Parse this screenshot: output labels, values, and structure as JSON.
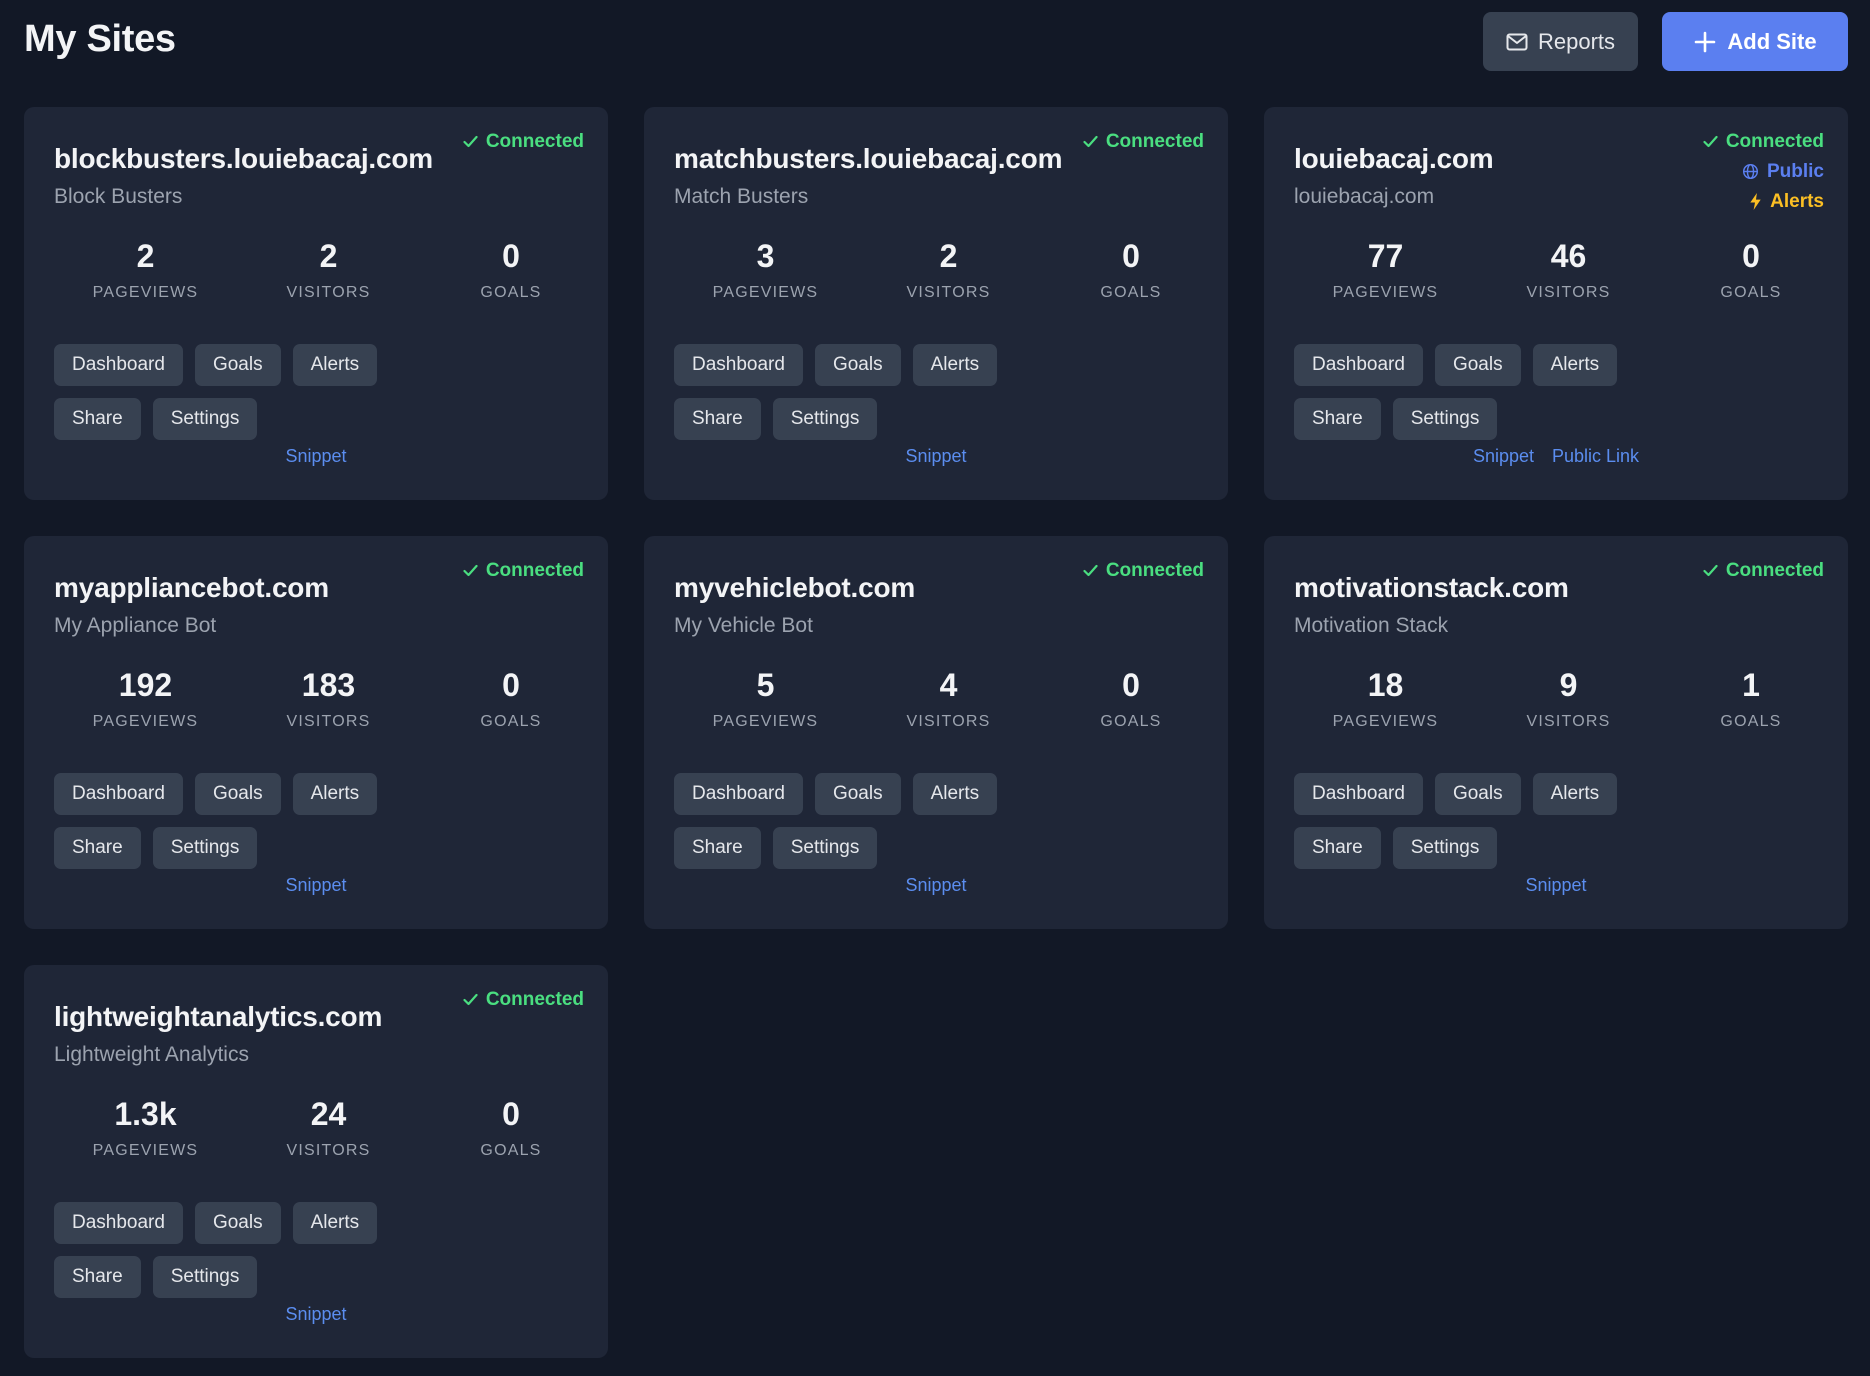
{
  "page": {
    "title": "My Sites",
    "reports_label": "Reports",
    "add_site_label": "Add Site"
  },
  "colors": {
    "background": "#121826",
    "card": "#1f2637",
    "button": "#374151",
    "accent": "#5b7ff0",
    "connected": "#4ade80",
    "alerts": "#fbbf24",
    "link": "#5b8def"
  },
  "icons": {
    "reports": "mail-icon",
    "add_site": "plus-icon",
    "connected": "check-icon",
    "public": "globe-icon",
    "alerts": "bolt-icon"
  },
  "labels": {
    "connected": "Connected",
    "public": "Public",
    "alerts": "Alerts",
    "pageviews": "PAGEVIEWS",
    "visitors": "VISITORS",
    "goals": "GOALS",
    "dashboard": "Dashboard",
    "goals_btn": "Goals",
    "alerts_btn": "Alerts",
    "share": "Share",
    "settings": "Settings",
    "snippet": "Snippet",
    "public_link": "Public Link"
  },
  "sites": [
    {
      "domain": "blockbusters.louiebacaj.com",
      "name": "Block Busters",
      "pageviews": "2",
      "visitors": "2",
      "goals": "0",
      "public": false,
      "alerts": false
    },
    {
      "domain": "matchbusters.louiebacaj.com",
      "name": "Match Busters",
      "pageviews": "3",
      "visitors": "2",
      "goals": "0",
      "public": false,
      "alerts": false
    },
    {
      "domain": "louiebacaj.com",
      "name": "louiebacaj.com",
      "pageviews": "77",
      "visitors": "46",
      "goals": "0",
      "public": true,
      "alerts": true
    },
    {
      "domain": "myappliancebot.com",
      "name": "My Appliance Bot",
      "pageviews": "192",
      "visitors": "183",
      "goals": "0",
      "public": false,
      "alerts": false
    },
    {
      "domain": "myvehiclebot.com",
      "name": "My Vehicle Bot",
      "pageviews": "5",
      "visitors": "4",
      "goals": "0",
      "public": false,
      "alerts": false
    },
    {
      "domain": "motivationstack.com",
      "name": "Motivation Stack",
      "pageviews": "18",
      "visitors": "9",
      "goals": "1",
      "public": false,
      "alerts": false
    },
    {
      "domain": "lightweightanalytics.com",
      "name": "Lightweight Analytics",
      "pageviews": "1.3k",
      "visitors": "24",
      "goals": "0",
      "public": false,
      "alerts": false
    }
  ]
}
